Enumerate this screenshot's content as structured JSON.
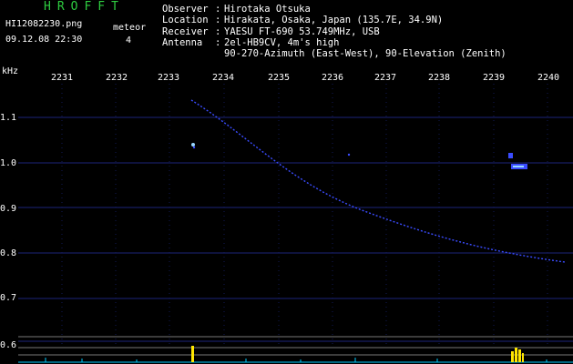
{
  "header": {
    "title": "HROFFT",
    "filename": "HI12082230.png",
    "datetime": "09.12.08 22:30",
    "meteor_label": "meteor",
    "meteor_count": "4"
  },
  "info": {
    "observer_key": "Observer",
    "observer_val": "Hirotaka Otsuka",
    "location_key": "Location",
    "location_val": "Hirakata, Osaka, Japan (135.7E, 34.9N)",
    "receiver_key": "Receiver",
    "receiver_val": "YAESU FT-690 53.749MHz, USB",
    "antenna_key": "Antenna",
    "antenna_val1": "2el-HB9CV, 4m's high",
    "antenna_val2": "90-270-Azimuth (East-West), 90-Elevation (Zenith)"
  },
  "axis": {
    "unit": "kHz",
    "x_ticks": [
      "2231",
      "2232",
      "2233",
      "2234",
      "2235",
      "2236",
      "2237",
      "2238",
      "2239",
      "2240"
    ],
    "y_ticks": [
      "1.1",
      "1.0",
      "0.9",
      "0.8",
      "0.7",
      "0.6"
    ]
  },
  "colors": {
    "background": "#000000",
    "title": "#2ecc40",
    "signal": "#3a4cff",
    "echo": "#9ad8ff",
    "baseline": "#00ccff",
    "spike": "#ffe600"
  }
}
